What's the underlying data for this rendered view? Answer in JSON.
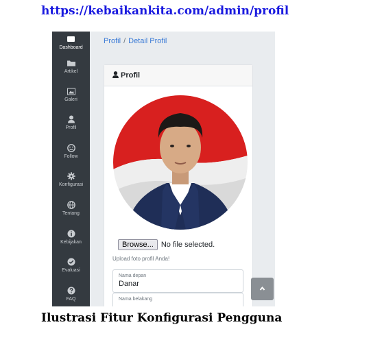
{
  "captions": {
    "url": "https://kebaikankita.com/admin/profil",
    "figure": "Ilustrasi Fitur Konfigurasi Pengguna"
  },
  "sidebar": {
    "items": [
      {
        "label": "Dashboard",
        "icon": "dashboard-icon"
      },
      {
        "label": "Artikel",
        "icon": "folder-icon"
      },
      {
        "label": "Galeri",
        "icon": "gallery-icon"
      },
      {
        "label": "Profil",
        "icon": "user-icon"
      },
      {
        "label": "Follow",
        "icon": "smile-icon"
      },
      {
        "label": "Konfigurasi",
        "icon": "gear-icon"
      },
      {
        "label": "Tentang",
        "icon": "globe-icon"
      },
      {
        "label": "Kebijakan",
        "icon": "info-icon"
      },
      {
        "label": "Evaluasi",
        "icon": "check-circle-icon"
      },
      {
        "label": "FAQ",
        "icon": "question-icon"
      }
    ]
  },
  "breadcrumb": {
    "root": "Profil",
    "separator": "/",
    "current": "Detail Profil"
  },
  "card": {
    "title": "Profil",
    "file_button": "Browse...",
    "file_status": "No file selected.",
    "upload_hint": "Upload foto profil Anda!",
    "fields": [
      {
        "label": "Nama depan",
        "value": "Danar"
      },
      {
        "label": "Nama belakang",
        "value": ""
      }
    ]
  },
  "colors": {
    "sidebar_bg": "#343a40",
    "link": "#3b7bd6",
    "flag_red": "#d8201f",
    "suit_navy": "#1f2e57"
  }
}
